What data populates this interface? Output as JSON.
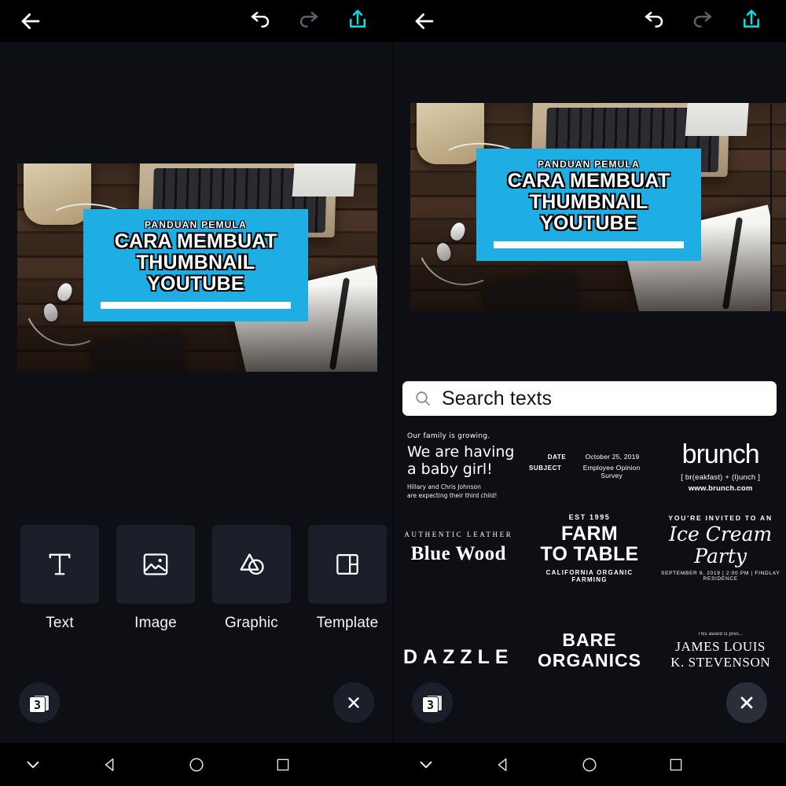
{
  "app": {
    "topbar": {
      "back_icon": "arrow-left-icon",
      "undo_icon": "undo-icon",
      "redo_icon": "redo-icon",
      "export_icon": "export-share-icon",
      "export_color": "#00e0e6",
      "undo_color": "#ffffff",
      "redo_color": "#5a5f68"
    },
    "canvas": {
      "overlay": {
        "kicker": "PANDUAN PEMULA",
        "line1": "CARA MEMBUAT",
        "line2": "THUMBNAIL",
        "line3": "YOUTUBE",
        "box_color": "#1eaee4",
        "text_color": "#ffffff"
      },
      "photo_description": "laptop-on-wooden-desk-photo"
    },
    "toolbar": {
      "items": [
        {
          "label": "Text",
          "icon": "text-t-icon"
        },
        {
          "label": "Image",
          "icon": "image-picture-icon"
        },
        {
          "label": "Graphic",
          "icon": "shapes-graphic-icon"
        },
        {
          "label": "Template",
          "icon": "template-layout-icon"
        },
        {
          "label": "",
          "icon": "partial-next-tool-icon"
        }
      ]
    },
    "layers_button": {
      "count": "3",
      "icon": "layers-stack-icon"
    },
    "close_button": {
      "icon": "close-x-icon"
    },
    "search": {
      "placeholder": "Search texts",
      "icon": "search-icon"
    },
    "text_templates": [
      {
        "id": "baby-announcement",
        "style": "handwritten",
        "lines": [
          "Our family is growing.",
          "We are having",
          "a baby girl!",
          "Hillary and Chris Johnson",
          "are expecting their third child!"
        ]
      },
      {
        "id": "memo-date-subject",
        "style": "key-value",
        "rows": [
          {
            "key": "DATE",
            "value": "October 25, 2019"
          },
          {
            "key": "SUBJECT",
            "value": "Employee  Opinion Survey"
          }
        ]
      },
      {
        "id": "brunch-logo",
        "style": "wordmark",
        "title": "brunch",
        "subtitle": "[ br(eakfast) + (l)unch ]",
        "url": "www.brunch.com"
      },
      {
        "id": "blue-wood-leather",
        "style": "serif-badge",
        "kicker": "AUTHENTIC LEATHER",
        "title": "Blue Wood"
      },
      {
        "id": "farm-to-table",
        "style": "stacked-badge",
        "kicker": "EST 1995",
        "line1": "FARM",
        "line2": "TO TABLE",
        "footer": "CALIFORNIA ORGANIC FARMING"
      },
      {
        "id": "ice-cream-party",
        "style": "invitation",
        "kicker": "YOU'RE INVITED TO AN",
        "title": "Ice Cream Party",
        "footer": "SEPTEMBER 9, 2019 | 2:00 PM | FINDLAY RESIDENCE"
      },
      {
        "id": "dazzle",
        "style": "spaced-wordmark",
        "title": "DAZZLE"
      },
      {
        "id": "bare-organics",
        "style": "stacked-wordmark",
        "line1": "BARE",
        "line2": "ORGANICS"
      },
      {
        "id": "award-certificate",
        "style": "certificate",
        "kicker": "This award is pres...",
        "line1": "JAMES LOUIS",
        "line2": "K. STEVENSON"
      }
    ],
    "navbar": {
      "items": [
        {
          "icon": "chevron-down-icon",
          "name": "hide-keyboard"
        },
        {
          "icon": "triangle-back-icon",
          "name": "back"
        },
        {
          "icon": "circle-home-icon",
          "name": "home"
        },
        {
          "icon": "square-recents-icon",
          "name": "recents"
        }
      ]
    }
  }
}
